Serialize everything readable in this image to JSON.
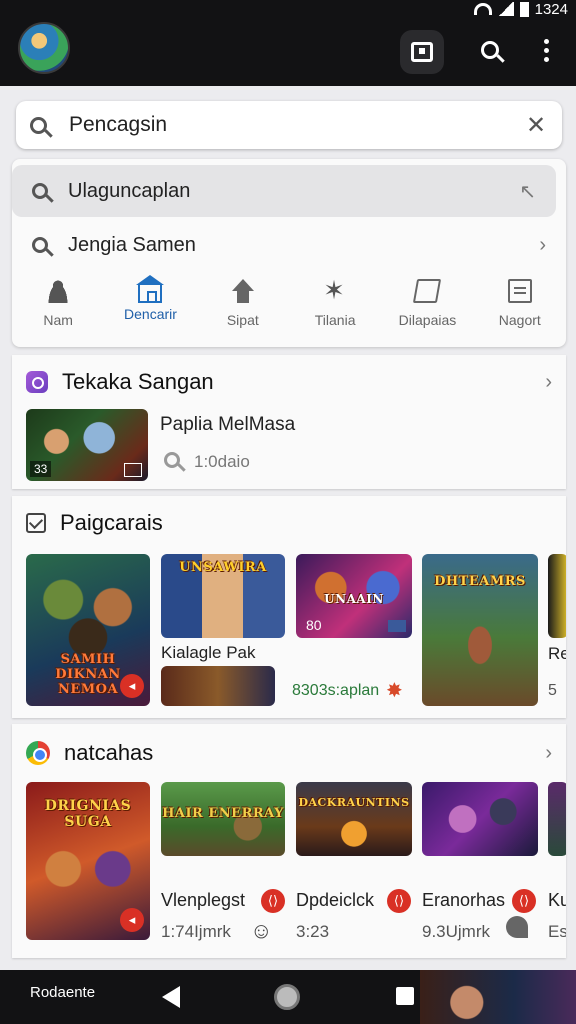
{
  "status": {
    "time": "1324"
  },
  "search": {
    "value": "Pencagsin"
  },
  "suggestions": [
    {
      "text": "Ulaguncaplan"
    },
    {
      "text": "Jengia Samen"
    }
  ],
  "categories": [
    {
      "label": "Nam",
      "icon": "person-icon"
    },
    {
      "label": "Dencarir",
      "icon": "home-icon",
      "active": true
    },
    {
      "label": "Sipat",
      "icon": "upload-icon"
    },
    {
      "label": "Tilania",
      "icon": "star-badge-icon"
    },
    {
      "label": "Dilapaias",
      "icon": "flag-icon"
    },
    {
      "label": "Nagort",
      "icon": "note-icon"
    }
  ],
  "section1": {
    "title": "Tekaka Sangan",
    "item": {
      "title": "Paplia MelMasa",
      "meta": "1:0daio",
      "tag": "33"
    }
  },
  "section2": {
    "title": "Paigcarais",
    "cards": [
      {
        "caption": "SAMIH DIKNAN NEMOA"
      },
      {
        "caption": "UNSAWIRA",
        "title": "Kialagle Pak",
        "meta": "8303s:aplan"
      },
      {
        "caption": "UNAAIN",
        "tag1": "80",
        "tag2": ""
      },
      {
        "caption": "DHTEAMRS"
      },
      {
        "title": "Re",
        "meta": "5"
      }
    ]
  },
  "section3": {
    "title": "natcahas",
    "cards": [
      {
        "caption": "DRIGNIAS SUGA",
        "title": "",
        "meta": ""
      },
      {
        "caption": "HAIR ENERRAY",
        "title": "Vlenplegst",
        "meta": "1:74Ijmrk"
      },
      {
        "caption": "DACKRAUNTINS",
        "title": "Dpdeiclck",
        "meta": "3:23"
      },
      {
        "caption": "",
        "title": "Eranorhas",
        "meta": "9.3Ujmrk"
      },
      {
        "title": "Ku",
        "meta": "Es"
      }
    ]
  },
  "navbar": {
    "label": "Rodaente"
  }
}
